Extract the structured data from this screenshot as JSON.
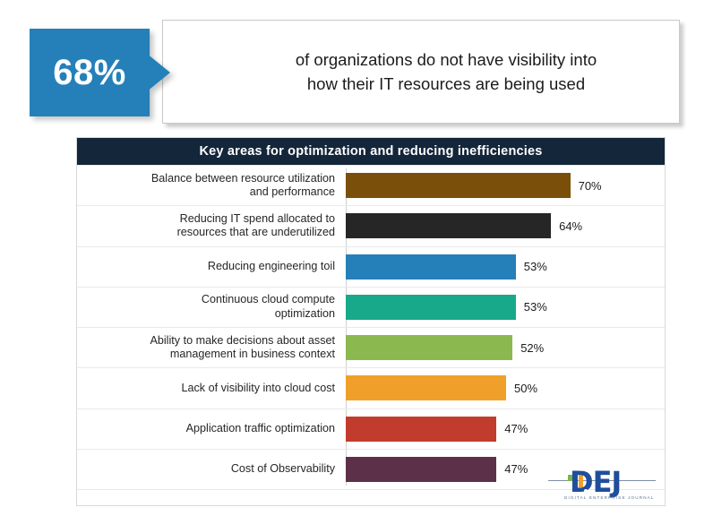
{
  "callout": {
    "percent": "68%",
    "statement": "of organizations do not have visibility into\nhow their IT resources are being used",
    "accent_color": "#2580b9"
  },
  "chart_panel": {
    "title": "Key areas for optimization  and reducing  inefficiencies",
    "header_color": "#13263a"
  },
  "logo": {
    "wordmark": "DEJ",
    "tagline": "DIGITAL ENTERPRISE JOURNAL"
  },
  "chart_data": {
    "type": "bar",
    "orientation": "horizontal",
    "title": "Key areas for optimization  and reducing  inefficiencies",
    "xlabel": "",
    "ylabel": "",
    "xlim": [
      0,
      100
    ],
    "grid": true,
    "legend": "none",
    "categories": [
      "Balance between  resource utilization\nand performance",
      "Reducing IT spend allocated to\nresources that are underutilized",
      "Reducing engineering toil",
      "Continuous  cloud compute\noptimization",
      "Ability to make decisions about asset\nmanagement in business context",
      "Lack of visibility into cloud cost",
      "Application traffic optimization",
      "Cost of Observability"
    ],
    "values": [
      70,
      64,
      53,
      53,
      52,
      50,
      47,
      47
    ],
    "value_labels": [
      "70%",
      "64%",
      "53%",
      "53%",
      "52%",
      "50%",
      "47%",
      "47%"
    ],
    "colors": [
      "#7a4f0a",
      "#262626",
      "#2580b9",
      "#18a98b",
      "#8cb94f",
      "#f0a02a",
      "#c23c2d",
      "#5c3048"
    ]
  }
}
